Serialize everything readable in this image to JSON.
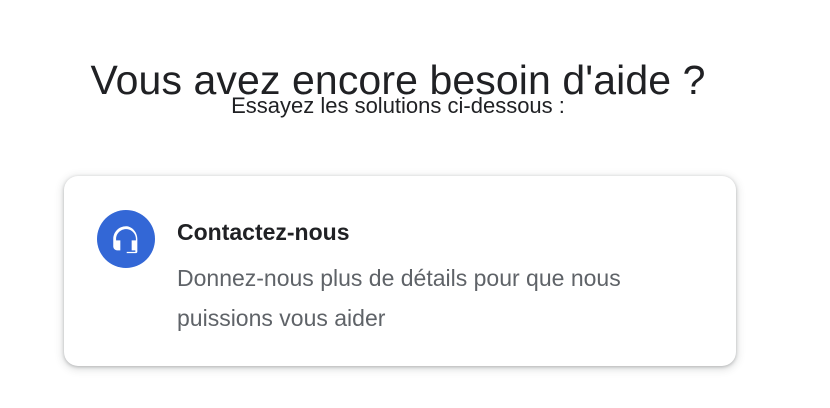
{
  "header": {
    "title": "Vous avez encore besoin d'aide ?",
    "subtitle": "Essayez les solutions ci-dessous :"
  },
  "contact_card": {
    "icon": "headset-support-icon",
    "title": "Contactez-nous",
    "description": "Donnez-nous plus de détails pour que nous puissions vous aider"
  },
  "colors": {
    "accent": "#3367d6",
    "title_text": "#202124",
    "description_text": "#5f6368",
    "background": "#ffffff"
  }
}
